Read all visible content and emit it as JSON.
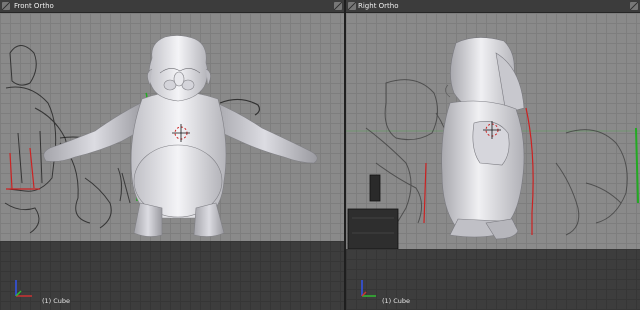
{
  "viewports": {
    "left": {
      "title": "Front Ortho",
      "object_label": "(1) Cube"
    },
    "right": {
      "title": "Right Ortho",
      "object_label": "(1) Cube"
    }
  },
  "colors": {
    "header_bg": "#3c3c3c",
    "viewport_grey": "#8a8a8a",
    "x_axis": "#cc3333",
    "y_axis": "#33bb33",
    "z_axis": "#3355ee",
    "sketch_red": "#cc2222",
    "sketch_green": "#22aa22"
  },
  "icons": {
    "corner": "split-corner-icon",
    "cursor": "3d-cursor-icon",
    "gizmo": "axis-gizmo-icon"
  }
}
